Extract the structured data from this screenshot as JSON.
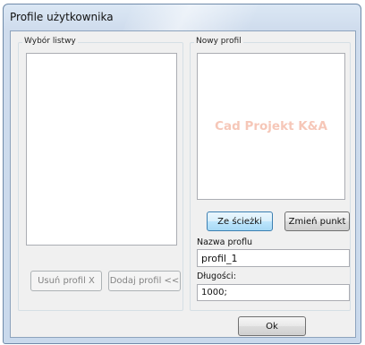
{
  "window": {
    "title": "Profile użytkownika"
  },
  "left_group": {
    "legend": "Wybór listwy",
    "buttons": {
      "remove_label": "Usuń profil X",
      "add_label": "Dodaj profil <<"
    }
  },
  "right_group": {
    "legend": "Nowy profil",
    "preview_watermark": "Cad Projekt K&A",
    "buttons": {
      "path_label": "Ze ścieżki",
      "change_point_label": "Zmień punkt"
    },
    "name_label": "Nazwa proflu",
    "name_value": "profil_1",
    "lengths_label": "Długości:",
    "lengths_value": "1000;"
  },
  "footer": {
    "ok_label": "Ok"
  },
  "colors": {
    "accent": "#3c7fb1",
    "watermark": "#f6c7b8"
  }
}
